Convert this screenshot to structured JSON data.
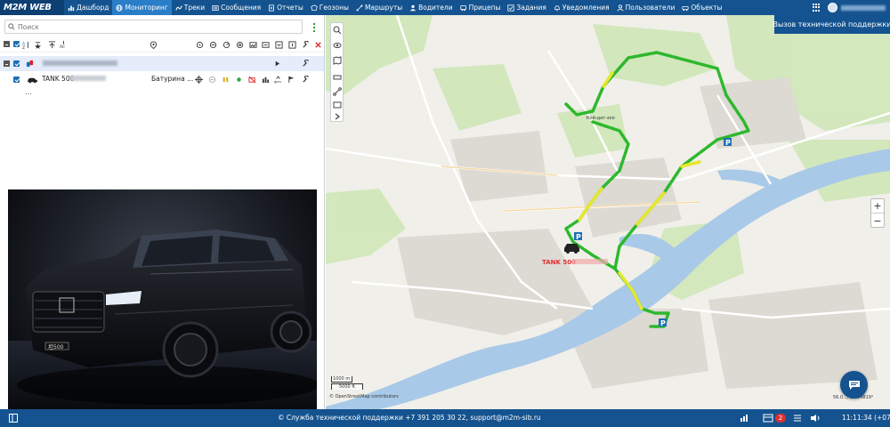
{
  "app": {
    "logo": "M2M WEB"
  },
  "nav": {
    "items": [
      {
        "label": "Дашборд",
        "icon": "bar-chart-icon"
      },
      {
        "label": "Мониторинг",
        "icon": "globe-icon",
        "active": true
      },
      {
        "label": "Треки",
        "icon": "tracks-icon"
      },
      {
        "label": "Сообщения",
        "icon": "messages-icon"
      },
      {
        "label": "Отчеты",
        "icon": "report-icon"
      },
      {
        "label": "Геозоны",
        "icon": "geofence-icon"
      },
      {
        "label": "Маршруты",
        "icon": "route-icon"
      },
      {
        "label": "Водители",
        "icon": "driver-icon"
      },
      {
        "label": "Прицепы",
        "icon": "trailer-icon"
      },
      {
        "label": "Задания",
        "icon": "tasks-icon"
      },
      {
        "label": "Уведомления",
        "icon": "bell-icon"
      },
      {
        "label": "Пользователи",
        "icon": "users-icon"
      },
      {
        "label": "Объекты",
        "icon": "car-icon"
      }
    ]
  },
  "left": {
    "search_placeholder": "Поиск",
    "unit": {
      "name": "TANK 500",
      "address": "Батурина ...",
      "status_color": "#2aa84a"
    },
    "more": "..."
  },
  "map": {
    "support_label": "Вызов технической поддержки",
    "unit_label": "TANK 500",
    "attribution": "© OpenStreetMap contributors",
    "scale_m": "1000 m",
    "scale_ft": "5000 ft",
    "coords": "56.0..., 93.04819°",
    "labels": {
      "zoo": "Кой-дат-зоо"
    },
    "colors": {
      "river": "#a9c9e8",
      "track_green": "#2db82d",
      "track_yellow": "#e7e72c",
      "park": "#c8e6b0"
    }
  },
  "footer": {
    "support": "© Служба технической поддержки +7 391 205 30 22, support@m2m-sib.ru",
    "badge": "2",
    "clock": "11:11:34 (+07)"
  }
}
